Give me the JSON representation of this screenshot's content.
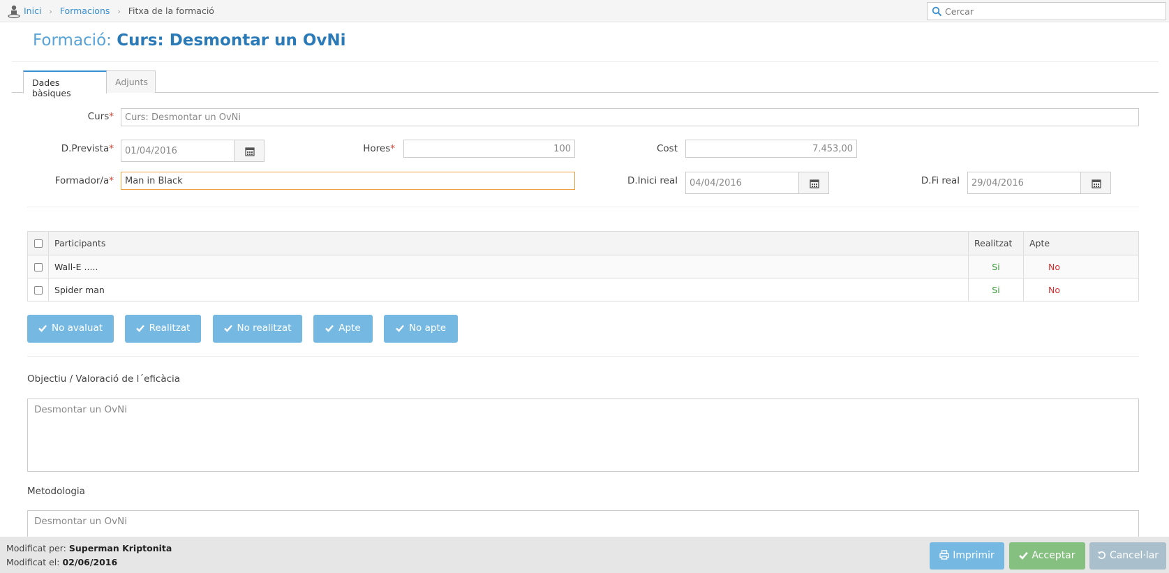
{
  "breadcrumb": {
    "items": [
      "Inici",
      "Formacions"
    ],
    "current": "Fitxa de la formació"
  },
  "search": {
    "placeholder": "Cercar"
  },
  "header": {
    "prefix": "Formació:",
    "title": "Curs: Desmontar un OvNi"
  },
  "tabs": [
    {
      "label": "Dades bàsiques",
      "active": true
    },
    {
      "label": "Adjunts",
      "active": false
    }
  ],
  "form": {
    "curs": {
      "label": "Curs",
      "value": "Curs: Desmontar un OvNi"
    },
    "data_prevista": {
      "label": "D.Prevista",
      "value": "01/04/2016"
    },
    "hores": {
      "label": "Hores",
      "value": "100"
    },
    "cost": {
      "label": "Cost",
      "value": "7.453,00"
    },
    "formador": {
      "label": "Formador/a",
      "value": "Man in Black"
    },
    "data_inici_real": {
      "label": "D.Inici real",
      "value": "04/04/2016"
    },
    "data_fi_real": {
      "label": "D.Fi real",
      "value": "29/04/2016"
    },
    "required_mark": "*"
  },
  "participants": {
    "columns": [
      "Participants",
      "Realitzat",
      "Apte"
    ],
    "rows": [
      {
        "name": "Wall-E .....",
        "realitzat": "Si",
        "apte": "No"
      },
      {
        "name": "Spider man",
        "realitzat": "Si",
        "apte": "No"
      }
    ]
  },
  "actions": [
    "No avaluat",
    "Realitzat",
    "No realitzat",
    "Apte",
    "No apte"
  ],
  "objectiu": {
    "label": "Objectiu / Valoració de l´eficàcia",
    "value": "Desmontar un OvNi"
  },
  "metodologia": {
    "label": "Metodologia",
    "value": "Desmontar un OvNi"
  },
  "footer": {
    "modified_by_label": "Modificat per:",
    "modified_by": "Superman Kriptonita",
    "modified_on_label": "Modificat el:",
    "modified_on": "02/06/2016",
    "print_label": "Imprimir",
    "accept_label": "Acceptar",
    "cancel_label": "Cancel·lar"
  },
  "colors": {
    "accent": "#3a8fd1",
    "action_button": "#75b9e2",
    "accept": "#86c080",
    "cancel": "#a9bfcc",
    "yes": "#3a9a3a",
    "no": "#d43030"
  }
}
